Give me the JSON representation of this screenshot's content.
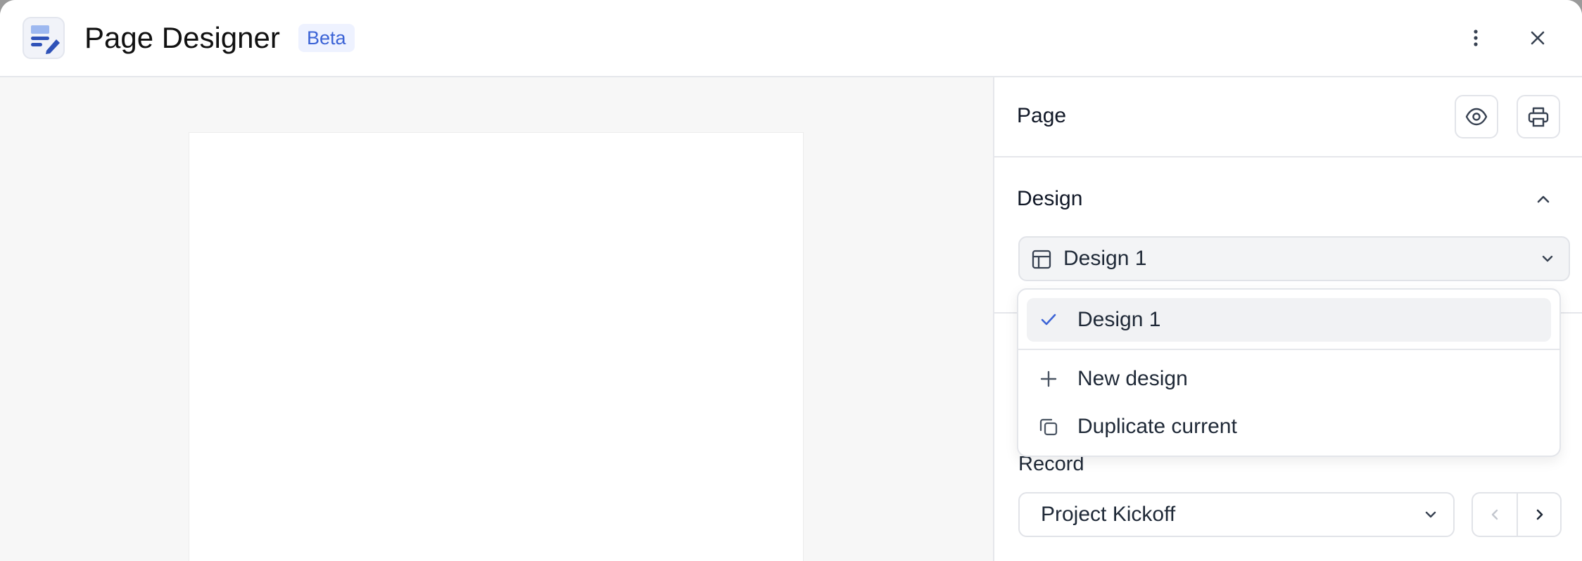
{
  "header": {
    "title": "Page Designer",
    "badge": "Beta",
    "app_icon": "page-designer-icon",
    "more_icon": "more-vertical-icon",
    "close_icon": "close-icon"
  },
  "panel": {
    "page_label": "Page",
    "preview_icon": "eye-icon",
    "print_icon": "printer-icon",
    "design_section": {
      "label": "Design",
      "collapse_icon": "chevron-up-icon",
      "selected_design": "Design 1"
    },
    "dropdown": {
      "items": [
        {
          "label": "Design 1",
          "icon": "check-icon",
          "selected": true
        },
        {
          "label": "New design",
          "icon": "plus-icon",
          "selected": false
        },
        {
          "label": "Duplicate current",
          "icon": "copy-icon",
          "selected": false
        }
      ]
    },
    "record": {
      "label": "Record",
      "selected": "Project Kickoff"
    }
  },
  "colors": {
    "accent": "#3b63d6",
    "badge_bg": "#eef2ff",
    "canvas_bg": "#f7f7f7",
    "border": "#e5e7eb"
  }
}
